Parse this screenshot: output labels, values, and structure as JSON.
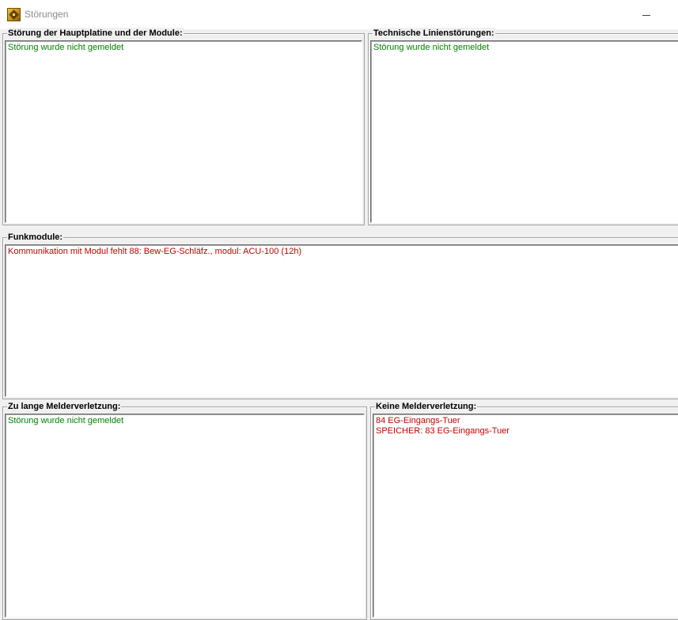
{
  "window": {
    "title": "Störungen"
  },
  "colors": {
    "ok_text": "#008000",
    "error_text": "#c00000"
  },
  "panels": {
    "hauptplatine": {
      "title": "Störung der Hauptplatine und der Module:",
      "rows": [
        "Störung wurde nicht gemeldet"
      ]
    },
    "linienstoerungen": {
      "title": "Technische Linienstörungen:",
      "rows": [
        "Störung wurde nicht gemeldet"
      ]
    },
    "funkmodule": {
      "title": "Funkmodule:",
      "rows": [
        "Kommunikation mit Modul fehlt 88: Bew-EG-Schläfz., modul: ACU-100   (12h)"
      ]
    },
    "zu_lange": {
      "title": "Zu lange Melderverletzung:",
      "rows": [
        "Störung wurde nicht gemeldet"
      ]
    },
    "keine": {
      "title": "Keine Melderverletzung:",
      "rows": [
        "84 EG-Eingangs-Tuer",
        "SPEICHER: 83 EG-Eingangs-Tuer"
      ]
    }
  }
}
